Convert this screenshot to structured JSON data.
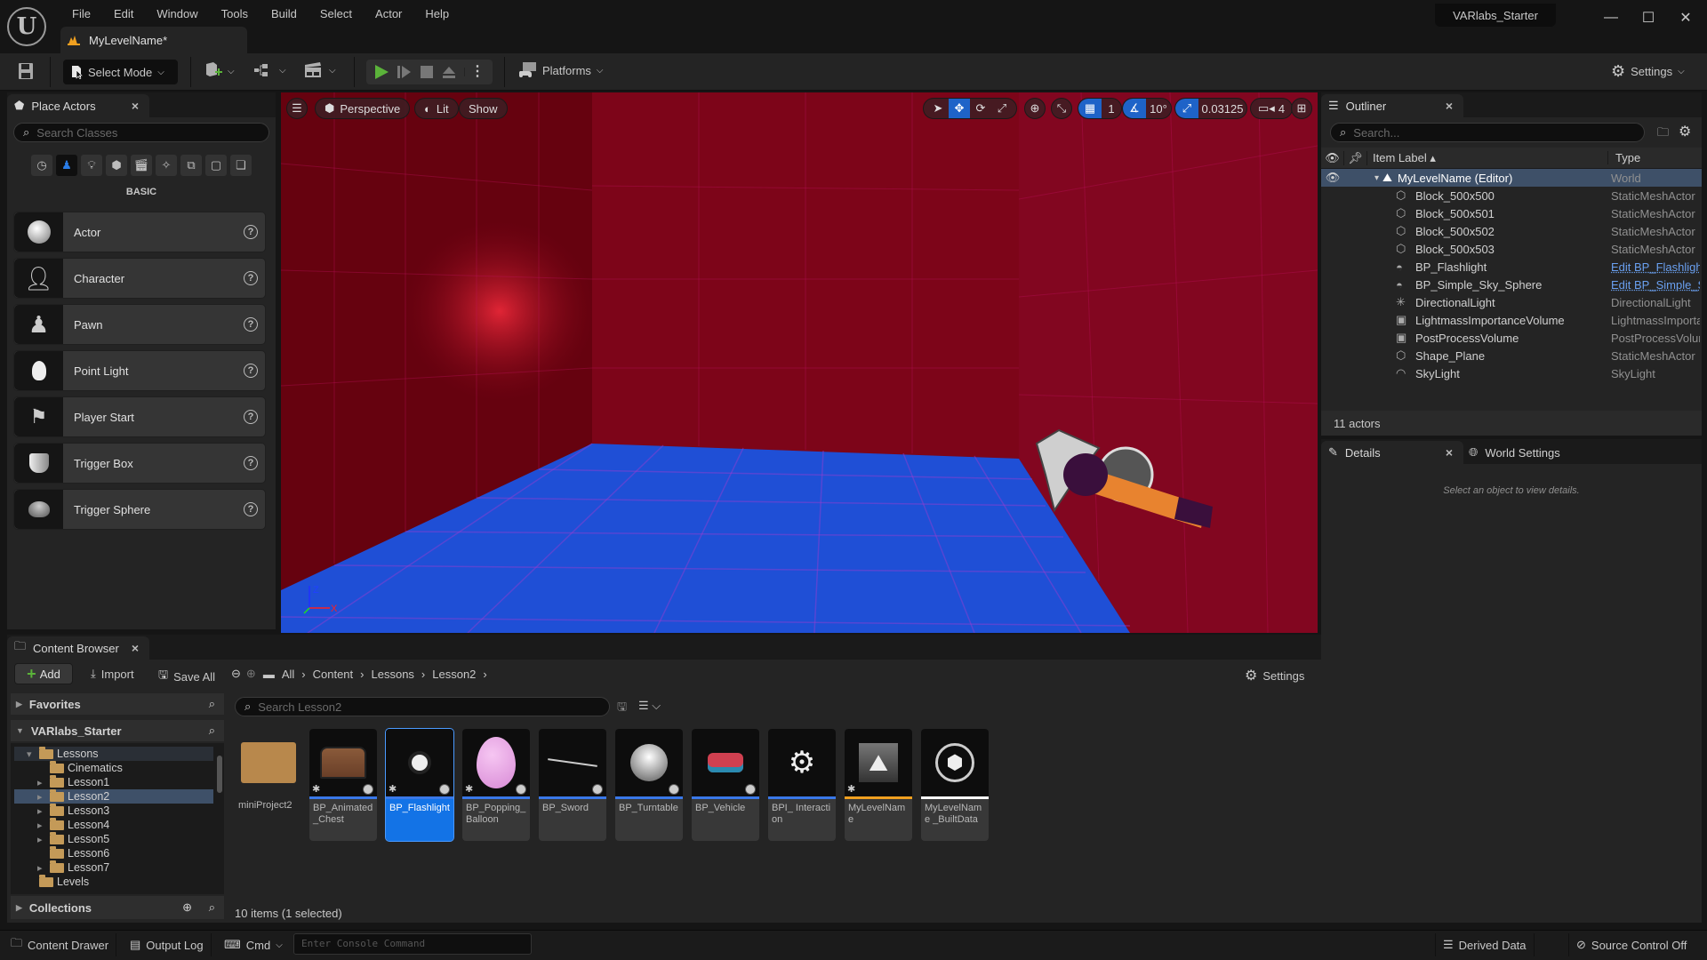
{
  "window": {
    "project_name": "VARlabs_Starter",
    "level_tab": "MyLevelName*",
    "menu": [
      "File",
      "Edit",
      "Window",
      "Tools",
      "Build",
      "Select",
      "Actor",
      "Help"
    ],
    "controls": {
      "minimize": "—",
      "maximize": "☐",
      "close": "✕"
    }
  },
  "toolbar": {
    "select_mode": "Select Mode",
    "platforms": "Platforms",
    "settings": "Settings",
    "accent_color": "#5bb33a"
  },
  "place_actors": {
    "tab_title": "Place Actors",
    "search_placeholder": "Search Classes",
    "category_icons": [
      "recent-icon",
      "basic-icon",
      "lights-icon",
      "shapes-icon",
      "cinematic-icon",
      "visual-effects-icon",
      "geometry-icon",
      "volumes-icon",
      "all-classes-icon"
    ],
    "selected_category": "BASIC",
    "actors": [
      {
        "label": "Actor",
        "icon": "actor-icon"
      },
      {
        "label": "Character",
        "icon": "character-icon"
      },
      {
        "label": "Pawn",
        "icon": "pawn-icon"
      },
      {
        "label": "Point Light",
        "icon": "point-light-icon"
      },
      {
        "label": "Player Start",
        "icon": "player-start-icon"
      },
      {
        "label": "Trigger Box",
        "icon": "trigger-box-icon"
      },
      {
        "label": "Trigger Sphere",
        "icon": "trigger-sphere-icon"
      }
    ]
  },
  "viewport": {
    "perspective": "Perspective",
    "lit": "Lit",
    "show": "Show",
    "grid_snap": "1",
    "rotation_snap": "10°",
    "scale_snap": "0.03125",
    "camera_speed": "4",
    "axis": {
      "x": "X",
      "z": "Z"
    }
  },
  "outliner": {
    "tab_title": "Outliner",
    "search_placeholder": "Search...",
    "col_label": "Item Label",
    "col_type": "Type",
    "root": {
      "label": "MyLevelName (Editor)",
      "type": "World"
    },
    "items": [
      {
        "label": "Block_500x500",
        "type": "StaticMeshActor",
        "link": false
      },
      {
        "label": "Block_500x501",
        "type": "StaticMeshActor",
        "link": false
      },
      {
        "label": "Block_500x502",
        "type": "StaticMeshActor",
        "link": false
      },
      {
        "label": "Block_500x503",
        "type": "StaticMeshActor",
        "link": false
      },
      {
        "label": "BP_Flashlight",
        "type": "Edit BP_Flashlight",
        "link": true
      },
      {
        "label": "BP_Simple_Sky_Sphere",
        "type": "Edit BP_Simple_Sky_Sphere",
        "link": true
      },
      {
        "label": "DirectionalLight",
        "type": "DirectionalLight",
        "link": false
      },
      {
        "label": "LightmassImportanceVolume",
        "type": "LightmassImportanceVolume",
        "link": false
      },
      {
        "label": "PostProcessVolume",
        "type": "PostProcessVolume",
        "link": false
      },
      {
        "label": "Shape_Plane",
        "type": "StaticMeshActor",
        "link": false
      },
      {
        "label": "SkyLight",
        "type": "SkyLight",
        "link": false
      }
    ],
    "footer": "11 actors"
  },
  "details": {
    "tab_title": "Details",
    "world_settings_tab": "World Settings",
    "empty_message": "Select an object to view details."
  },
  "content_browser": {
    "tab_title": "Content Browser",
    "add": "Add",
    "import": "Import",
    "save_all": "Save All",
    "breadcrumb": [
      "All",
      "Content",
      "Lessons",
      "Lesson2"
    ],
    "settings": "Settings",
    "favorites": "Favorites",
    "project": "VARlabs_Starter",
    "collections": "Collections",
    "search_placeholder": "Search Lesson2",
    "tree": [
      {
        "label": "Lessons",
        "expanded": true,
        "depth": 0,
        "arrow": "down"
      },
      {
        "label": "Cinematics",
        "depth": 1,
        "arrow": ""
      },
      {
        "label": "Lesson1",
        "depth": 1,
        "arrow": "right"
      },
      {
        "label": "Lesson2",
        "depth": 1,
        "arrow": "right",
        "selected": true
      },
      {
        "label": "Lesson3",
        "depth": 1,
        "arrow": "right"
      },
      {
        "label": "Lesson4",
        "depth": 1,
        "arrow": "right"
      },
      {
        "label": "Lesson5",
        "depth": 1,
        "arrow": "right"
      },
      {
        "label": "Lesson6",
        "depth": 1,
        "arrow": ""
      },
      {
        "label": "Lesson7",
        "depth": 1,
        "arrow": "right"
      },
      {
        "label": "Levels",
        "depth": 0,
        "arrow": ""
      }
    ],
    "assets": [
      {
        "label": "miniProject2",
        "kind": "folder"
      },
      {
        "label": "BP_Animated _Chest",
        "kind": "blueprint",
        "bar": "#3a78e8"
      },
      {
        "label": "BP_Flashlight",
        "kind": "blueprint",
        "bar": "#3a78e8",
        "selected": true
      },
      {
        "label": "BP_Popping_ Balloon",
        "kind": "blueprint",
        "bar": "#3a78e8"
      },
      {
        "label": "BP_Sword",
        "kind": "blueprint",
        "bar": "#3a78e8"
      },
      {
        "label": "BP_Turntable",
        "kind": "blueprint",
        "bar": "#3a78e8"
      },
      {
        "label": "BP_Vehicle",
        "kind": "blueprint",
        "bar": "#3a78e8"
      },
      {
        "label": "BPI_ Interaction",
        "kind": "interface",
        "bar": "#3a78e8"
      },
      {
        "label": "MyLevelName",
        "kind": "level",
        "bar": "#f0a020"
      },
      {
        "label": "MyLevelName _BuiltData",
        "kind": "data",
        "bar": "#ffffff"
      }
    ],
    "status": "10 items (1 selected)"
  },
  "statusbar": {
    "content_drawer": "Content Drawer",
    "output_log": "Output Log",
    "cmd": "Cmd",
    "console_placeholder": "Enter Console Command",
    "derived_data": "Derived Data",
    "source_control": "Source Control Off"
  }
}
